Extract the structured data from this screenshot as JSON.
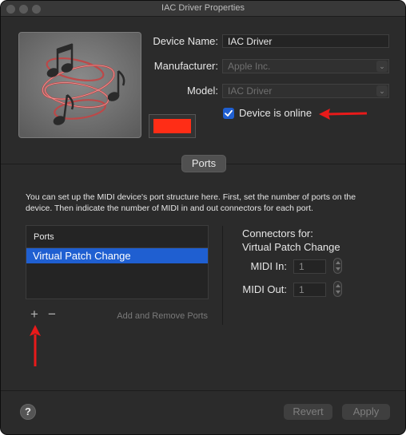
{
  "window": {
    "title": "IAC Driver Properties"
  },
  "device": {
    "name_label": "Device Name:",
    "name_value": "IAC Driver",
    "manufacturer_label": "Manufacturer:",
    "manufacturer_placeholder": "Apple Inc.",
    "model_label": "Model:",
    "model_placeholder": "IAC Driver",
    "online_label": "Device is online",
    "online_checked": true,
    "color": "#ff2d16"
  },
  "tabs": {
    "ports_label": "Ports"
  },
  "description": "You can set up the MIDI device's port structure here. First, set the number of ports on the device. Then indicate the number of MIDI in and out connectors for each port.",
  "ports": {
    "header": "Ports",
    "items": [
      "Virtual Patch Change"
    ],
    "selected_index": 0,
    "add_symbol": "+",
    "remove_symbol": "−",
    "add_remove_label": "Add and Remove Ports"
  },
  "connectors": {
    "title_line1": "Connectors for:",
    "title_line2": "Virtual Patch Change",
    "midi_in_label": "MIDI In:",
    "midi_in_value": "1",
    "midi_out_label": "MIDI Out:",
    "midi_out_value": "1"
  },
  "footer": {
    "help_symbol": "?",
    "revert_label": "Revert",
    "apply_label": "Apply"
  },
  "colors": {
    "accent": "#1f5fd1",
    "annotation_arrow": "#e81a1a",
    "window_bg": "#2b2b2b"
  },
  "icons": {
    "device_icon": "music-notes-swirl-icon"
  }
}
